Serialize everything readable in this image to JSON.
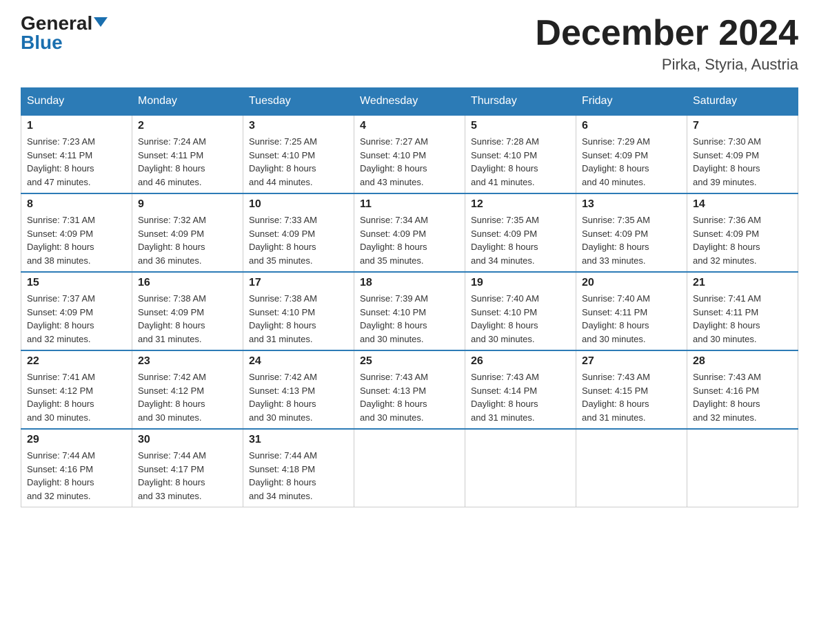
{
  "header": {
    "logo_general": "General",
    "logo_blue": "Blue",
    "month_title": "December 2024",
    "location": "Pirka, Styria, Austria"
  },
  "weekdays": [
    "Sunday",
    "Monday",
    "Tuesday",
    "Wednesday",
    "Thursday",
    "Friday",
    "Saturday"
  ],
  "weeks": [
    [
      {
        "day": "1",
        "sunrise": "7:23 AM",
        "sunset": "4:11 PM",
        "daylight": "8 hours and 47 minutes."
      },
      {
        "day": "2",
        "sunrise": "7:24 AM",
        "sunset": "4:11 PM",
        "daylight": "8 hours and 46 minutes."
      },
      {
        "day": "3",
        "sunrise": "7:25 AM",
        "sunset": "4:10 PM",
        "daylight": "8 hours and 44 minutes."
      },
      {
        "day": "4",
        "sunrise": "7:27 AM",
        "sunset": "4:10 PM",
        "daylight": "8 hours and 43 minutes."
      },
      {
        "day": "5",
        "sunrise": "7:28 AM",
        "sunset": "4:10 PM",
        "daylight": "8 hours and 41 minutes."
      },
      {
        "day": "6",
        "sunrise": "7:29 AM",
        "sunset": "4:09 PM",
        "daylight": "8 hours and 40 minutes."
      },
      {
        "day": "7",
        "sunrise": "7:30 AM",
        "sunset": "4:09 PM",
        "daylight": "8 hours and 39 minutes."
      }
    ],
    [
      {
        "day": "8",
        "sunrise": "7:31 AM",
        "sunset": "4:09 PM",
        "daylight": "8 hours and 38 minutes."
      },
      {
        "day": "9",
        "sunrise": "7:32 AM",
        "sunset": "4:09 PM",
        "daylight": "8 hours and 36 minutes."
      },
      {
        "day": "10",
        "sunrise": "7:33 AM",
        "sunset": "4:09 PM",
        "daylight": "8 hours and 35 minutes."
      },
      {
        "day": "11",
        "sunrise": "7:34 AM",
        "sunset": "4:09 PM",
        "daylight": "8 hours and 35 minutes."
      },
      {
        "day": "12",
        "sunrise": "7:35 AM",
        "sunset": "4:09 PM",
        "daylight": "8 hours and 34 minutes."
      },
      {
        "day": "13",
        "sunrise": "7:35 AM",
        "sunset": "4:09 PM",
        "daylight": "8 hours and 33 minutes."
      },
      {
        "day": "14",
        "sunrise": "7:36 AM",
        "sunset": "4:09 PM",
        "daylight": "8 hours and 32 minutes."
      }
    ],
    [
      {
        "day": "15",
        "sunrise": "7:37 AM",
        "sunset": "4:09 PM",
        "daylight": "8 hours and 32 minutes."
      },
      {
        "day": "16",
        "sunrise": "7:38 AM",
        "sunset": "4:09 PM",
        "daylight": "8 hours and 31 minutes."
      },
      {
        "day": "17",
        "sunrise": "7:38 AM",
        "sunset": "4:10 PM",
        "daylight": "8 hours and 31 minutes."
      },
      {
        "day": "18",
        "sunrise": "7:39 AM",
        "sunset": "4:10 PM",
        "daylight": "8 hours and 30 minutes."
      },
      {
        "day": "19",
        "sunrise": "7:40 AM",
        "sunset": "4:10 PM",
        "daylight": "8 hours and 30 minutes."
      },
      {
        "day": "20",
        "sunrise": "7:40 AM",
        "sunset": "4:11 PM",
        "daylight": "8 hours and 30 minutes."
      },
      {
        "day": "21",
        "sunrise": "7:41 AM",
        "sunset": "4:11 PM",
        "daylight": "8 hours and 30 minutes."
      }
    ],
    [
      {
        "day": "22",
        "sunrise": "7:41 AM",
        "sunset": "4:12 PM",
        "daylight": "8 hours and 30 minutes."
      },
      {
        "day": "23",
        "sunrise": "7:42 AM",
        "sunset": "4:12 PM",
        "daylight": "8 hours and 30 minutes."
      },
      {
        "day": "24",
        "sunrise": "7:42 AM",
        "sunset": "4:13 PM",
        "daylight": "8 hours and 30 minutes."
      },
      {
        "day": "25",
        "sunrise": "7:43 AM",
        "sunset": "4:13 PM",
        "daylight": "8 hours and 30 minutes."
      },
      {
        "day": "26",
        "sunrise": "7:43 AM",
        "sunset": "4:14 PM",
        "daylight": "8 hours and 31 minutes."
      },
      {
        "day": "27",
        "sunrise": "7:43 AM",
        "sunset": "4:15 PM",
        "daylight": "8 hours and 31 minutes."
      },
      {
        "day": "28",
        "sunrise": "7:43 AM",
        "sunset": "4:16 PM",
        "daylight": "8 hours and 32 minutes."
      }
    ],
    [
      {
        "day": "29",
        "sunrise": "7:44 AM",
        "sunset": "4:16 PM",
        "daylight": "8 hours and 32 minutes."
      },
      {
        "day": "30",
        "sunrise": "7:44 AM",
        "sunset": "4:17 PM",
        "daylight": "8 hours and 33 minutes."
      },
      {
        "day": "31",
        "sunrise": "7:44 AM",
        "sunset": "4:18 PM",
        "daylight": "8 hours and 34 minutes."
      },
      null,
      null,
      null,
      null
    ]
  ],
  "labels": {
    "sunrise": "Sunrise:",
    "sunset": "Sunset:",
    "daylight": "Daylight:"
  }
}
